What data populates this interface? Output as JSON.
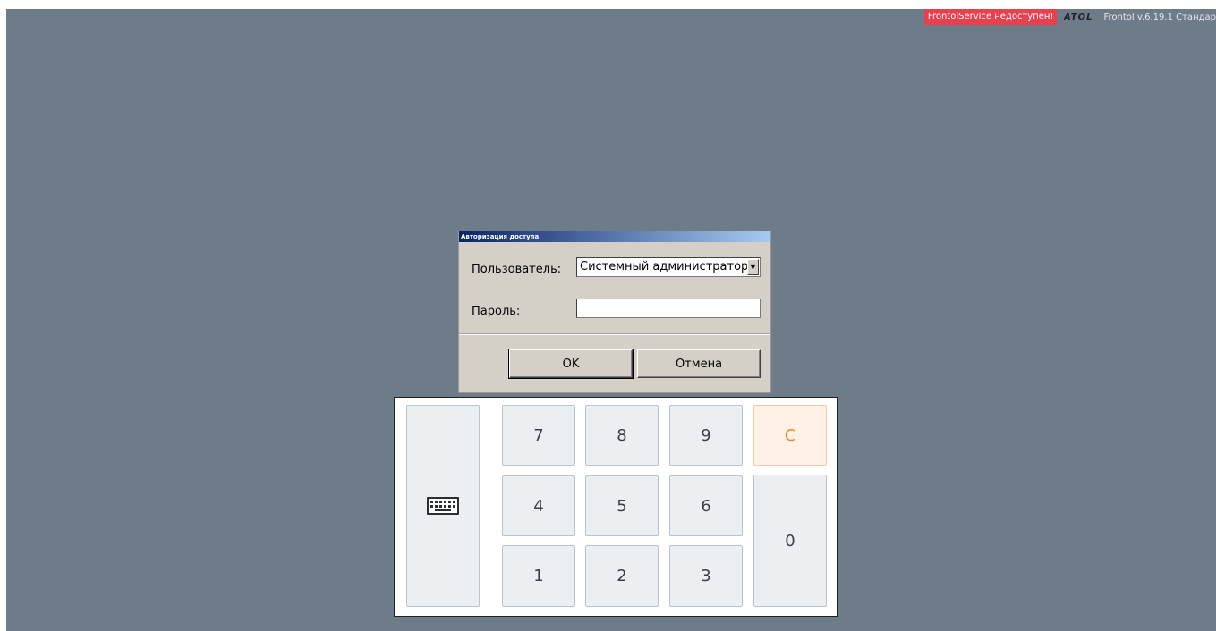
{
  "topbar": {
    "service_warning": "FrontolService недоступен!",
    "brand_logo": "ATOL",
    "version": "Frontol v.6.19.1 Стандар"
  },
  "dialog": {
    "title": "Авторизация доступа",
    "user_label": "Пользователь:",
    "user_value": "Системный администратор",
    "password_label": "Пароль:",
    "password_value": "",
    "ok_label": "OK",
    "cancel_label": "Отмена"
  },
  "keypad": {
    "keyboard_icon": "keyboard-icon",
    "keys": {
      "k7": "7",
      "k8": "8",
      "k9": "9",
      "clear": "C",
      "k4": "4",
      "k5": "5",
      "k6": "6",
      "k1": "1",
      "k2": "2",
      "k3": "3",
      "k0": "0"
    }
  }
}
